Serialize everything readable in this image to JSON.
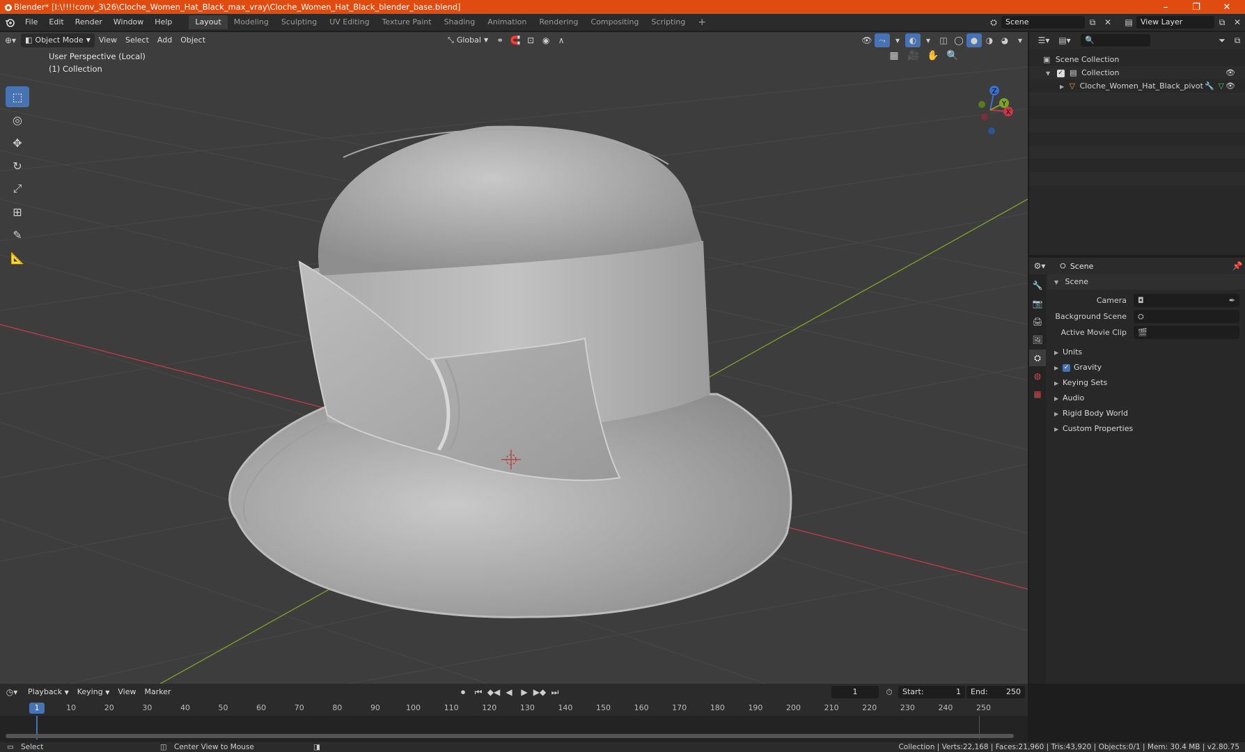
{
  "window": {
    "title": "Blender* [I:\\!!!!conv_3\\26\\Cloche_Women_Hat_Black_max_vray\\Cloche_Women_Hat_Black_blender_base.blend]",
    "minimize": "–",
    "restore": "❐",
    "close": "✕"
  },
  "menu": {
    "items": [
      "File",
      "Edit",
      "Render",
      "Window",
      "Help"
    ],
    "workspaces": [
      "Layout",
      "Modeling",
      "Sculpting",
      "UV Editing",
      "Texture Paint",
      "Shading",
      "Animation",
      "Rendering",
      "Compositing",
      "Scripting"
    ],
    "add_workspace": "+",
    "scene": "Scene",
    "view_layer": "View Layer"
  },
  "viewport": {
    "mode": "Object Mode",
    "menus": [
      "View",
      "Select",
      "Add",
      "Object"
    ],
    "transform_orientation": "Global",
    "perspective_label": "User Perspective (Local)",
    "collection_label": "(1) Collection",
    "gizmo": {
      "z": "Z",
      "y": "Y",
      "x": "X"
    }
  },
  "outliner": {
    "scene_collection": "Scene Collection",
    "collection": "Collection",
    "object": "Cloche_Women_Hat_Black_pivot"
  },
  "properties": {
    "context": "Scene",
    "section": "Scene",
    "fields": [
      {
        "label": "Camera"
      },
      {
        "label": "Background Scene"
      },
      {
        "label": "Active Movie Clip"
      }
    ],
    "panels": [
      "Units",
      "Gravity",
      "Keying Sets",
      "Audio",
      "Rigid Body World",
      "Custom Properties"
    ],
    "gravity_checked": true
  },
  "timeline": {
    "menus": [
      "Playback",
      "Keying",
      "View",
      "Marker"
    ],
    "current_frame": "1",
    "start_label": "Start:",
    "start": "1",
    "end_label": "End:",
    "end": "250",
    "ticks": [
      "10",
      "20",
      "30",
      "40",
      "50",
      "60",
      "70",
      "80",
      "90",
      "100",
      "110",
      "120",
      "130",
      "140",
      "150",
      "160",
      "170",
      "180",
      "190",
      "200",
      "210",
      "220",
      "230",
      "240",
      "250"
    ],
    "playhead": "1"
  },
  "status": {
    "select": "Select",
    "center": "Center View to Mouse",
    "stats": "Collection | Verts:22,168 | Faces:21,960 | Tris:43,920 | Objects:0/1 | Mem: 30.4 MB | v2.80.75"
  },
  "colors": {
    "titlebar": "#e04b0f",
    "accent": "#4772b3",
    "x_axis": "#c6384b",
    "y_axis": "#7fa32a"
  }
}
